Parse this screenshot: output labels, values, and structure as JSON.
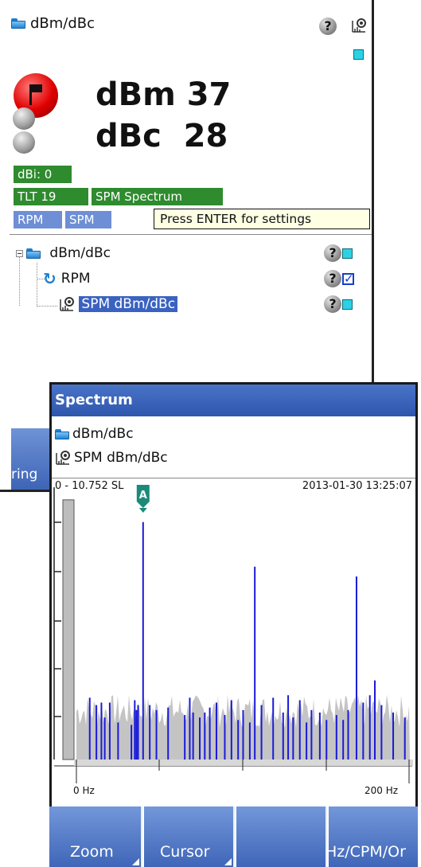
{
  "main_window": {
    "title": "dBm/dBc",
    "dbm_value": "dBm 37",
    "dbc_value": "dBc  28",
    "tags": {
      "dbi": "dBi: 0",
      "tlt": "TLT 19",
      "spm_spectrum": "SPM Spectrum",
      "rpm": "RPM",
      "spm": "SPM"
    },
    "tooltip": "Press ENTER for settings",
    "tree": {
      "root_label": "dBm/dBc",
      "rpm_label": "RPM",
      "spm_label": "SPM dBm/dBc"
    },
    "bottom_button_label": "ring"
  },
  "spectrum_window": {
    "title": "Spectrum",
    "path_folder": "dBm/dBc",
    "path_measurement": "SPM dBm/dBc",
    "range_label": "0 - 10.752 SL",
    "timestamp": "2013-01-30 13:25:07",
    "x_start_label": "0 Hz",
    "x_end_label": "200 Hz",
    "cursor_label": "A",
    "toolbar": {
      "zoom": "Zoom",
      "cursor": "Cursor",
      "blank": "",
      "units": "Hz/CPM/Or"
    }
  },
  "colors": {
    "accent_blue": "#3a62c0",
    "tag_green": "#2e8b2e",
    "tag_blue": "#6e8fd6",
    "spectrum_line": "#1a1ad8",
    "noise_floor": "#c4c4c4",
    "cursor_teal": "#1b8a7a"
  },
  "chart_data": {
    "type": "bar",
    "x_unit": "Hz",
    "xlim": [
      0,
      200
    ],
    "ylim": [
      0,
      10.752
    ],
    "cursor": {
      "label": "A",
      "x": 40
    },
    "series": [
      {
        "values": [
          [
            5,
            0.05
          ],
          [
            8,
            2.5
          ],
          [
            12,
            2.2
          ],
          [
            15,
            2.3
          ],
          [
            17,
            1.7
          ],
          [
            20,
            2.3
          ],
          [
            25,
            1.5
          ],
          [
            33,
            1.4
          ],
          [
            35,
            2.4
          ],
          [
            36,
            2.0
          ],
          [
            37,
            2.2
          ],
          [
            40,
            9.6
          ],
          [
            44,
            2.2
          ],
          [
            48,
            2.0
          ],
          [
            55,
            2.1
          ],
          [
            65,
            1.8
          ],
          [
            68,
            2.5
          ],
          [
            70,
            1.9
          ],
          [
            74,
            1.7
          ],
          [
            77,
            1.9
          ],
          [
            80,
            2.1
          ],
          [
            84,
            2.3
          ],
          [
            89,
            1.8
          ],
          [
            93,
            2.4
          ],
          [
            97,
            1.6
          ],
          [
            100,
            2.0
          ],
          [
            104,
            1.5
          ],
          [
            107,
            7.8
          ],
          [
            111,
            2.2
          ],
          [
            118,
            2.5
          ],
          [
            124,
            1.9
          ],
          [
            127,
            2.6
          ],
          [
            130,
            1.7
          ],
          [
            134,
            2.4
          ],
          [
            138,
            1.5
          ],
          [
            141,
            2.0
          ],
          [
            146,
            1.9
          ],
          [
            150,
            1.6
          ],
          [
            156,
            1.8
          ],
          [
            160,
            1.6
          ],
          [
            163,
            2.0
          ],
          [
            168,
            7.4
          ],
          [
            172,
            2.3
          ],
          [
            176,
            2.6
          ],
          [
            179,
            3.2
          ],
          [
            183,
            2.2
          ],
          [
            190,
            1.9
          ],
          [
            197,
            1.7
          ]
        ]
      }
    ]
  }
}
